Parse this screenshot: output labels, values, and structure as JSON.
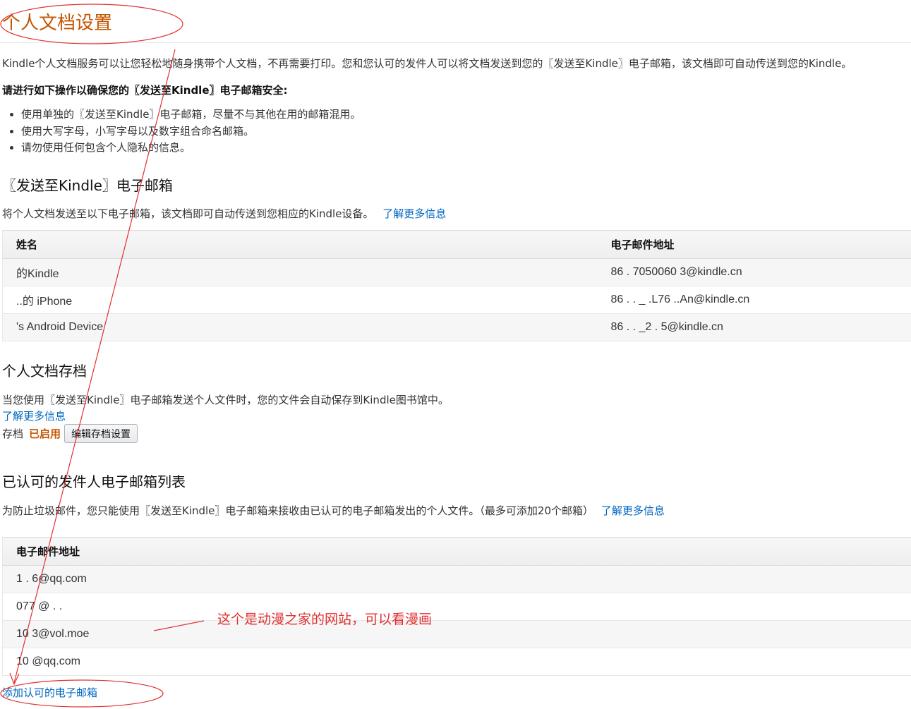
{
  "page": {
    "title": "个人文档设置"
  },
  "intro": {
    "text": "Kindle个人文档服务可以让您轻松地随身携带个人文档，不再需要打印。您和您认可的发件人可以将文档发送到您的〖发送至Kindle〗电子邮箱，该文档即可自动传送到您的Kindle。",
    "tips_heading": "请进行如下操作以确保您的〖发送至Kindle〗电子邮箱安全:",
    "tips": [
      "使用单独的〖发送至Kindle〗电子邮箱，尽量不与其他在用的邮箱混用。",
      "使用大写字母，小写字母以及数字组合命名邮箱。",
      "请勿使用任何包含个人隐私的信息。"
    ]
  },
  "send_to_kindle": {
    "heading": "〖发送至Kindle〗电子邮箱",
    "description": "将个人文档发送至以下电子邮箱，该文档即可自动传送到您相应的Kindle设备。",
    "learn_more": "了解更多信息",
    "columns": [
      "姓名",
      "电子邮件地址"
    ],
    "rows": [
      {
        "name": "的Kindle",
        "email": "86 .  7050060  3@kindle.cn"
      },
      {
        "name": "..的 iPhone",
        "email": "86 . .      _ .L76 ..An@kindle.cn"
      },
      {
        "name": "'s Android Device",
        "email": "86 . .       _2   . 5@kindle.cn"
      }
    ]
  },
  "archive": {
    "heading": "个人文档存档",
    "description": "当您使用〖发送至Kindle〗电子邮箱发送个人文件时，您的文件会自动保存到Kindle图书馆中。",
    "learn_more": "了解更多信息",
    "status_label": "存档",
    "status_value": "已启用",
    "edit_button": "编辑存档设置"
  },
  "approved": {
    "heading": "已认可的发件人电子邮箱列表",
    "description": "为防止垃圾邮件，您只能使用〖发送至Kindle〗电子邮箱来接收由已认可的电子邮箱发出的个人文件。（最多可添加20个邮箱）",
    "learn_more": "了解更多信息",
    "column": "电子邮件地址",
    "rows": [
      "1 .      6@qq.com",
      "077         @ . .",
      "10          3@vol.moe",
      "10          @qq.com"
    ],
    "add_link": "添加认可的电子邮箱"
  },
  "annotation": {
    "note": "这个是动漫之家的网站，可以看漫画",
    "color": "#e03131"
  },
  "colors": {
    "title": "#c45500",
    "link": "#0066c0",
    "annotation_red": "#e03131"
  }
}
